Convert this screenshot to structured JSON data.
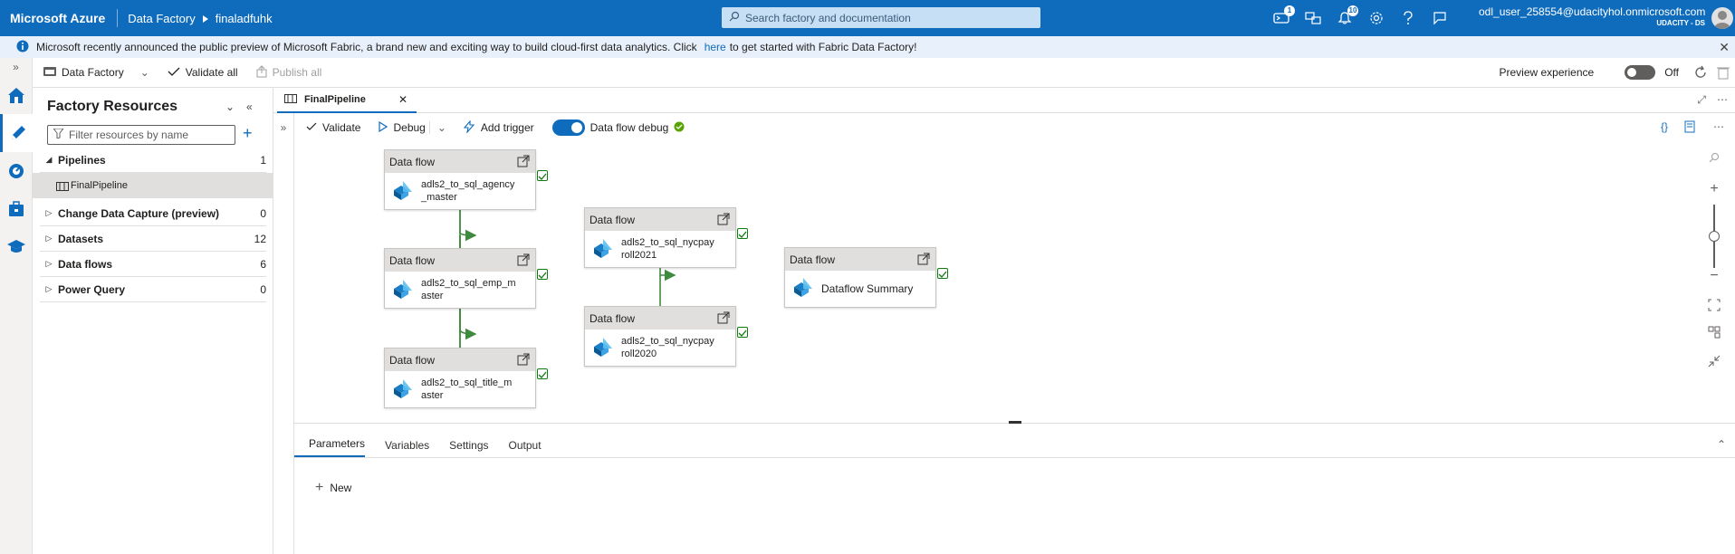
{
  "topbar": {
    "brand": "Microsoft Azure",
    "crumb1": "Data Factory",
    "crumb2": "finaladfuhk",
    "search_placeholder": "Search factory and documentation",
    "badge_cloud": "1",
    "badge_bell": "10",
    "user_email": "odl_user_258554@udacityhol.onmicrosoft.com",
    "user_tenant": "UDACITY - DS"
  },
  "banner": {
    "text_before": "Microsoft recently announced the public preview of Microsoft Fabric, a brand new and exciting way to build cloud-first data analytics. Click",
    "link": "here",
    "text_after": "to get started with Fabric Data Factory!"
  },
  "toolbar1": {
    "data_factory": "Data Factory",
    "validate_all": "Validate all",
    "publish_all": "Publish all",
    "preview_label": "Preview experience",
    "preview_state": "Off"
  },
  "resources": {
    "title": "Factory Resources",
    "filter_placeholder": "Filter resources by name",
    "items": [
      {
        "label": "Pipelines",
        "count": "1"
      },
      {
        "label": "FinalPipeline"
      },
      {
        "label": "Change Data Capture (preview)",
        "count": "0"
      },
      {
        "label": "Datasets",
        "count": "12"
      },
      {
        "label": "Data flows",
        "count": "6"
      },
      {
        "label": "Power Query",
        "count": "0"
      }
    ]
  },
  "tab": {
    "label": "FinalPipeline"
  },
  "toolbar2": {
    "validate": "Validate",
    "debug": "Debug",
    "add_trigger": "Add trigger",
    "dataflow_debug": "Data flow debug"
  },
  "pipeline": {
    "nodes": [
      {
        "type": "Data flow",
        "name": "adls2_to_sql_agency_master"
      },
      {
        "type": "Data flow",
        "name": "adls2_to_sql_emp_master"
      },
      {
        "type": "Data flow",
        "name": "adls2_to_sql_title_master"
      },
      {
        "type": "Data flow",
        "name": "adls2_to_sql_nycpayroll2021"
      },
      {
        "type": "Data flow",
        "name": "adls2_to_sql_nycpayroll2020"
      },
      {
        "type": "Data flow",
        "name": "Dataflow Summary"
      }
    ]
  },
  "bottom": {
    "tabs": [
      "Parameters",
      "Variables",
      "Settings",
      "Output"
    ],
    "new": "New"
  },
  "colors": {
    "azure_blue": "#0f6cbd",
    "success_green": "#107c10"
  }
}
